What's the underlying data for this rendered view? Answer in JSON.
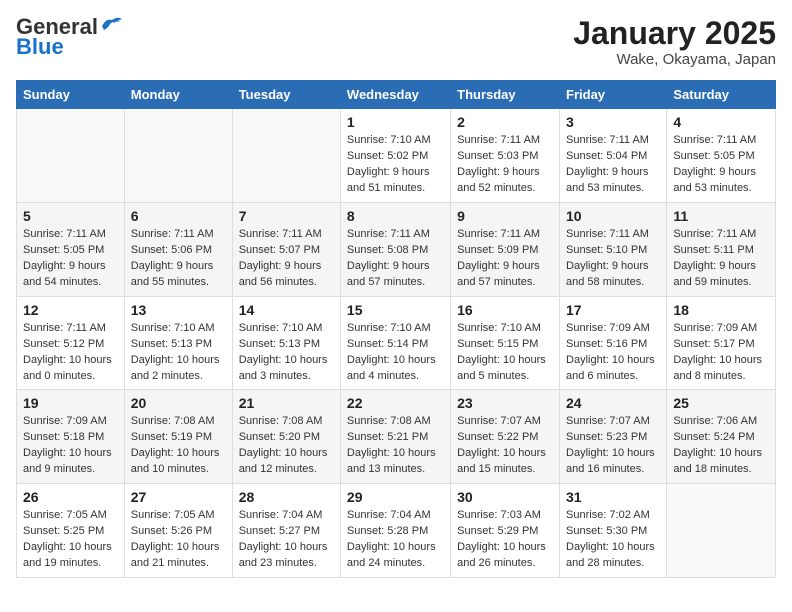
{
  "logo": {
    "general": "General",
    "blue": "Blue"
  },
  "title": "January 2025",
  "location": "Wake, Okayama, Japan",
  "days_of_week": [
    "Sunday",
    "Monday",
    "Tuesday",
    "Wednesday",
    "Thursday",
    "Friday",
    "Saturday"
  ],
  "weeks": [
    [
      {
        "day": "",
        "info": ""
      },
      {
        "day": "",
        "info": ""
      },
      {
        "day": "",
        "info": ""
      },
      {
        "day": "1",
        "info": "Sunrise: 7:10 AM\nSunset: 5:02 PM\nDaylight: 9 hours and 51 minutes."
      },
      {
        "day": "2",
        "info": "Sunrise: 7:11 AM\nSunset: 5:03 PM\nDaylight: 9 hours and 52 minutes."
      },
      {
        "day": "3",
        "info": "Sunrise: 7:11 AM\nSunset: 5:04 PM\nDaylight: 9 hours and 53 minutes."
      },
      {
        "day": "4",
        "info": "Sunrise: 7:11 AM\nSunset: 5:05 PM\nDaylight: 9 hours and 53 minutes."
      }
    ],
    [
      {
        "day": "5",
        "info": "Sunrise: 7:11 AM\nSunset: 5:05 PM\nDaylight: 9 hours and 54 minutes."
      },
      {
        "day": "6",
        "info": "Sunrise: 7:11 AM\nSunset: 5:06 PM\nDaylight: 9 hours and 55 minutes."
      },
      {
        "day": "7",
        "info": "Sunrise: 7:11 AM\nSunset: 5:07 PM\nDaylight: 9 hours and 56 minutes."
      },
      {
        "day": "8",
        "info": "Sunrise: 7:11 AM\nSunset: 5:08 PM\nDaylight: 9 hours and 57 minutes."
      },
      {
        "day": "9",
        "info": "Sunrise: 7:11 AM\nSunset: 5:09 PM\nDaylight: 9 hours and 57 minutes."
      },
      {
        "day": "10",
        "info": "Sunrise: 7:11 AM\nSunset: 5:10 PM\nDaylight: 9 hours and 58 minutes."
      },
      {
        "day": "11",
        "info": "Sunrise: 7:11 AM\nSunset: 5:11 PM\nDaylight: 9 hours and 59 minutes."
      }
    ],
    [
      {
        "day": "12",
        "info": "Sunrise: 7:11 AM\nSunset: 5:12 PM\nDaylight: 10 hours and 0 minutes."
      },
      {
        "day": "13",
        "info": "Sunrise: 7:10 AM\nSunset: 5:13 PM\nDaylight: 10 hours and 2 minutes."
      },
      {
        "day": "14",
        "info": "Sunrise: 7:10 AM\nSunset: 5:13 PM\nDaylight: 10 hours and 3 minutes."
      },
      {
        "day": "15",
        "info": "Sunrise: 7:10 AM\nSunset: 5:14 PM\nDaylight: 10 hours and 4 minutes."
      },
      {
        "day": "16",
        "info": "Sunrise: 7:10 AM\nSunset: 5:15 PM\nDaylight: 10 hours and 5 minutes."
      },
      {
        "day": "17",
        "info": "Sunrise: 7:09 AM\nSunset: 5:16 PM\nDaylight: 10 hours and 6 minutes."
      },
      {
        "day": "18",
        "info": "Sunrise: 7:09 AM\nSunset: 5:17 PM\nDaylight: 10 hours and 8 minutes."
      }
    ],
    [
      {
        "day": "19",
        "info": "Sunrise: 7:09 AM\nSunset: 5:18 PM\nDaylight: 10 hours and 9 minutes."
      },
      {
        "day": "20",
        "info": "Sunrise: 7:08 AM\nSunset: 5:19 PM\nDaylight: 10 hours and 10 minutes."
      },
      {
        "day": "21",
        "info": "Sunrise: 7:08 AM\nSunset: 5:20 PM\nDaylight: 10 hours and 12 minutes."
      },
      {
        "day": "22",
        "info": "Sunrise: 7:08 AM\nSunset: 5:21 PM\nDaylight: 10 hours and 13 minutes."
      },
      {
        "day": "23",
        "info": "Sunrise: 7:07 AM\nSunset: 5:22 PM\nDaylight: 10 hours and 15 minutes."
      },
      {
        "day": "24",
        "info": "Sunrise: 7:07 AM\nSunset: 5:23 PM\nDaylight: 10 hours and 16 minutes."
      },
      {
        "day": "25",
        "info": "Sunrise: 7:06 AM\nSunset: 5:24 PM\nDaylight: 10 hours and 18 minutes."
      }
    ],
    [
      {
        "day": "26",
        "info": "Sunrise: 7:05 AM\nSunset: 5:25 PM\nDaylight: 10 hours and 19 minutes."
      },
      {
        "day": "27",
        "info": "Sunrise: 7:05 AM\nSunset: 5:26 PM\nDaylight: 10 hours and 21 minutes."
      },
      {
        "day": "28",
        "info": "Sunrise: 7:04 AM\nSunset: 5:27 PM\nDaylight: 10 hours and 23 minutes."
      },
      {
        "day": "29",
        "info": "Sunrise: 7:04 AM\nSunset: 5:28 PM\nDaylight: 10 hours and 24 minutes."
      },
      {
        "day": "30",
        "info": "Sunrise: 7:03 AM\nSunset: 5:29 PM\nDaylight: 10 hours and 26 minutes."
      },
      {
        "day": "31",
        "info": "Sunrise: 7:02 AM\nSunset: 5:30 PM\nDaylight: 10 hours and 28 minutes."
      },
      {
        "day": "",
        "info": ""
      }
    ]
  ]
}
